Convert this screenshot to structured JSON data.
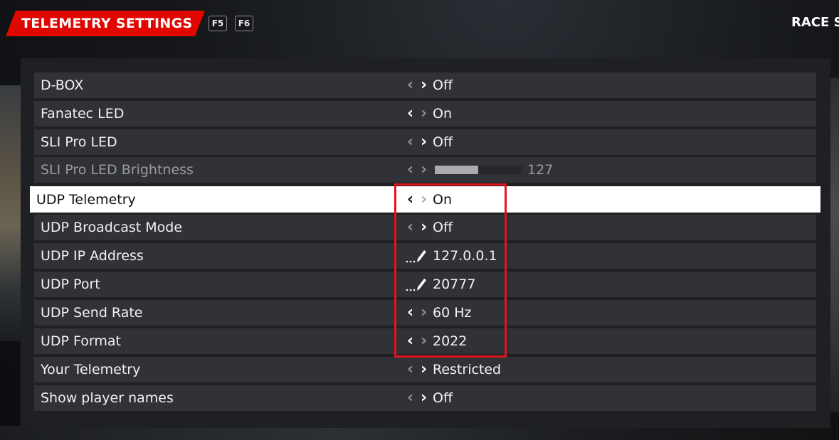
{
  "header": {
    "title": "TELEMETRY SETTINGS",
    "key_prev": "F5",
    "key_next": "F6",
    "next_tab": "RACE S"
  },
  "colors": {
    "accent_red": "#e10600",
    "highlight_box": "#e0151b",
    "row_bg": "#303238",
    "panel_bg": "#1e2024"
  },
  "settings": [
    {
      "label": "D-BOX",
      "value": "Off"
    },
    {
      "label": "Fanatec LED",
      "value": "On"
    },
    {
      "label": "SLI Pro LED",
      "value": "Off"
    },
    {
      "label": "SLI Pro LED Brightness",
      "value": "127",
      "slider_fraction": 0.5,
      "disabled": true
    },
    {
      "label": "UDP Telemetry",
      "value": "On",
      "selected": true
    },
    {
      "label": "UDP Broadcast Mode",
      "value": "Off"
    },
    {
      "label": "UDP IP Address",
      "value": "127.0.0.1",
      "icon": "edit-pencil-icon"
    },
    {
      "label": "UDP Port",
      "value": "20777",
      "icon": "edit-pencil-icon"
    },
    {
      "label": "UDP Send Rate",
      "value": "60 Hz"
    },
    {
      "label": "UDP Format",
      "value": "2022"
    },
    {
      "label": "Your Telemetry",
      "value": "Restricted"
    },
    {
      "label": "Show player names",
      "value": "Off"
    }
  ]
}
